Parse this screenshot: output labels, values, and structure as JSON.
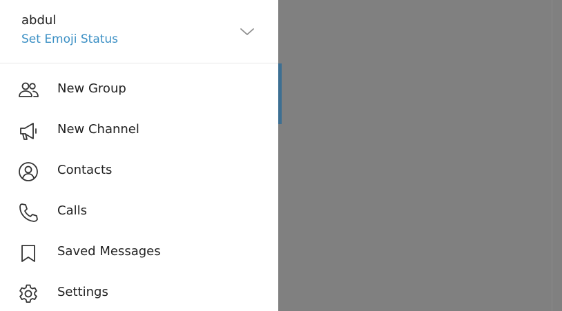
{
  "account": {
    "username": "abdul",
    "emoji_status_label": "Set Emoji Status"
  },
  "menu": {
    "items": [
      {
        "label": "New Group",
        "icon": "group-icon"
      },
      {
        "label": "New Channel",
        "icon": "megaphone-icon"
      },
      {
        "label": "Contacts",
        "icon": "contact-icon"
      },
      {
        "label": "Calls",
        "icon": "phone-icon"
      },
      {
        "label": "Saved Messages",
        "icon": "bookmark-icon"
      },
      {
        "label": "Settings",
        "icon": "gear-icon"
      }
    ]
  },
  "colors": {
    "accent": "#3a8fc4",
    "overlay": "#808080",
    "text": "#1f1f1f"
  }
}
